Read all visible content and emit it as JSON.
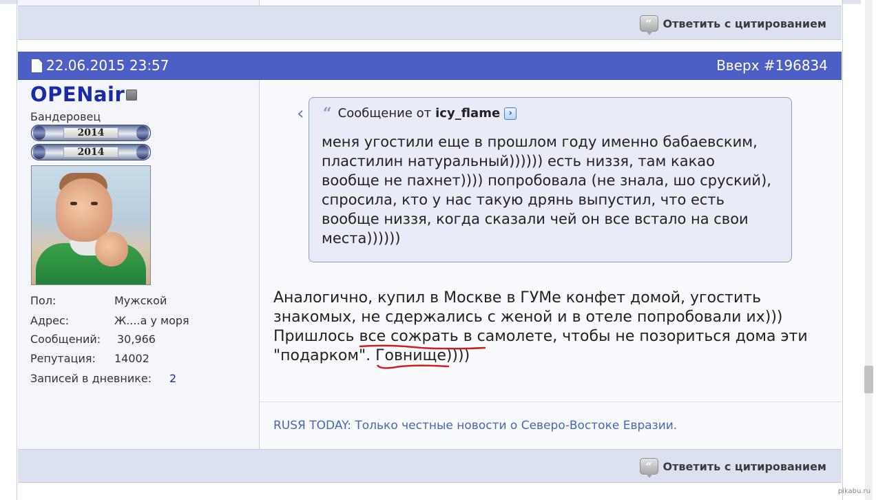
{
  "previous_post": {
    "reply_quote_label": "Ответить с цитированием"
  },
  "post": {
    "date": "22.06.2015 23:57",
    "top_link": "Вверх",
    "post_number": "#196834",
    "user": {
      "name": "OPENair",
      "title": "Бандеровец",
      "awards": [
        "2014",
        "2014"
      ],
      "info": [
        {
          "label": "Пол:",
          "value": "Мужской"
        },
        {
          "label": "Адрес:",
          "value": "Ж....а у моря"
        },
        {
          "label": "Сообщений:",
          "value": "30,966"
        },
        {
          "label": "Репутация:",
          "value": "14002"
        },
        {
          "label": "Записей в дневнике:",
          "value": "2"
        }
      ]
    },
    "quote": {
      "prefix": "Сообщение от",
      "author": "icy_flame",
      "text": "меня угостили еще в прошлом году именно бабаевским, пластилин натуральный)))))) есть низзя, там какао вообще не пахнет)))) попробовала (не знала, шо сруский), спросила, кто у нас такую дрянь выпустил, что есть вообще низзя, когда сказали чей он все встало на свои места))))))"
    },
    "message": {
      "line1": "Аналогично, купил в Москве в ГУМе конфет домой, угостить",
      "line2": "знакомых, не сдержались с женой и в отеле попробовали их)))",
      "line3": "Пришлось все сожрать в самолете, чтобы не позориться дома эти",
      "line4": "\"подарком\". Говнище))))"
    },
    "signature": {
      "source": "RUSЯ TODAY:",
      "text": " Только честные новости о Северо-Востоке Евразии."
    },
    "reply_quote_label": "Ответить с цитированием"
  },
  "watermark": "pikabu.ru",
  "colors": {
    "header_bg": "#4d5ec4",
    "username": "#1a2aa8",
    "footer_bg": "#dbe1ee",
    "quote_bg": "#e9ecf6",
    "underline": "#d11f1f"
  }
}
